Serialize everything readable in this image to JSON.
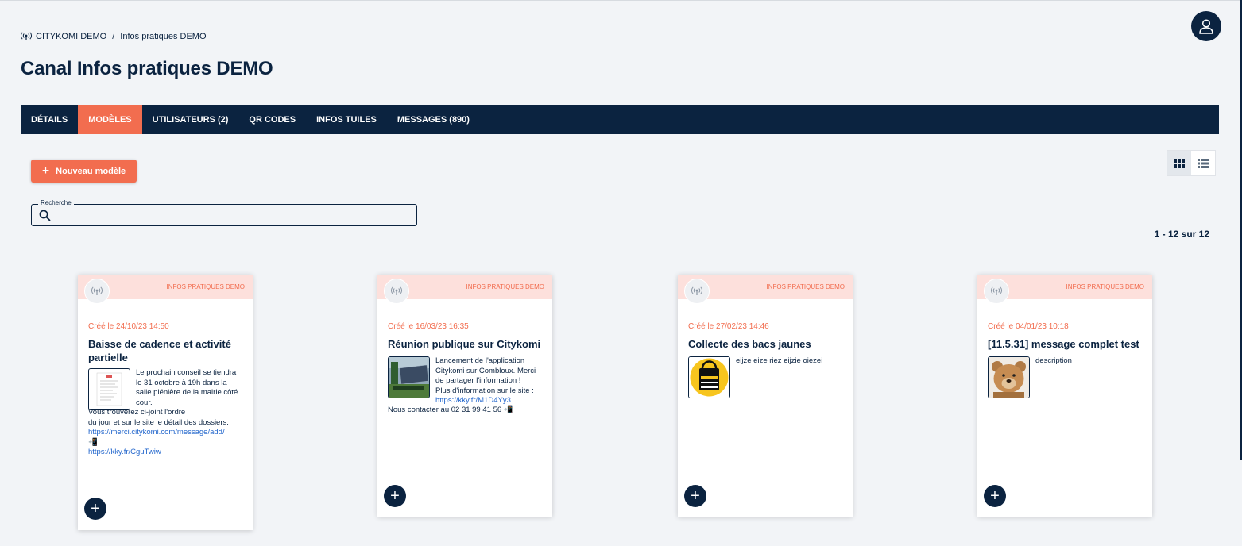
{
  "breadcrumb": {
    "root": "CITYKOMI DEMO",
    "separator": "/",
    "current": "Infos pratiques DEMO"
  },
  "page_title": "Canal Infos pratiques DEMO",
  "tabs": [
    {
      "label": "DÉTAILS"
    },
    {
      "label": "MODÈLES",
      "active": true
    },
    {
      "label": "UTILISATEURS (2)"
    },
    {
      "label": "QR CODES"
    },
    {
      "label": "INFOS TUILES"
    },
    {
      "label": "MESSAGES (890)"
    }
  ],
  "toolbar": {
    "new_label": "Nouveau modèle",
    "plus": "+"
  },
  "search": {
    "label": "Recherche",
    "placeholder": ""
  },
  "pagination": "1 - 12 sur 12",
  "colors": {
    "navy": "#0b2340",
    "accent": "#f26d4f",
    "card_header": "#fde0dc",
    "link": "#2266cc"
  },
  "cards": [
    {
      "channel": "INFOS PRATIQUES DEMO",
      "date": "Créé le 24/10/23 14:50",
      "title": "Baisse de cadence et activité partielle",
      "desc_lines": [
        "Le prochain conseil se tiendra",
        "le 31 octobre à 19h dans la",
        "salle plénière de la mairie côté",
        "cour."
      ],
      "more_lines": [
        "Vous trouverez ci-joint l'ordre",
        "du jour et sur le site le détail des dossiers."
      ],
      "link1": "https://merci.citykomi.com/message/add/",
      "link1_suffix": "📲",
      "link2": "https://kky.fr/CguTwiw"
    },
    {
      "channel": "INFOS PRATIQUES DEMO",
      "date": "Créé le 16/03/23 16:35",
      "title": "Réunion publique sur Citykomi",
      "desc_lines": [
        "Lancement de l'application",
        "Citykomi sur Combloux. Merci",
        "de partager l'information !",
        "Plus d'information sur le site :"
      ],
      "link": "https://kky.fr/M1D4Yy3",
      "more": "Nous contacter au 02 31 99 41 56 📲"
    },
    {
      "channel": "INFOS PRATIQUES DEMO",
      "date": "Créé le 27/02/23 14:46",
      "title": "Collecte des bacs jaunes",
      "desc": "eijze eize riez eijzie oiezei"
    },
    {
      "channel": "INFOS PRATIQUES DEMO",
      "date": "Créé le 04/01/23 10:18",
      "title": "[11.5.31] message complet test",
      "desc": "description"
    }
  ]
}
